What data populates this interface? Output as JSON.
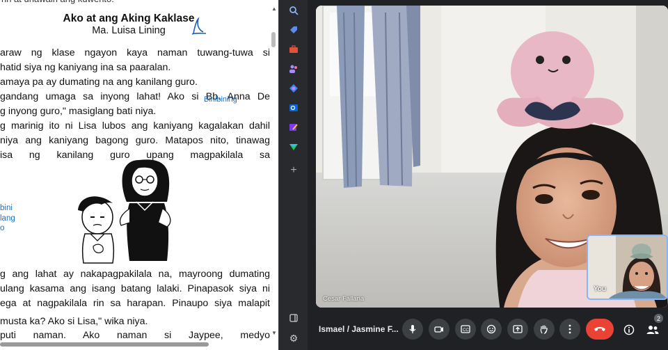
{
  "document": {
    "top_fragment": "rin at unawain ang kuwento.",
    "title": "Ako at ang Aking Kaklase",
    "author": "Ma. Luisa Lining",
    "paragraph1": [
      "araw ng klase ngayon kaya naman tuwang-tuwa si",
      "hatid siya ng kaniyang ina sa paaralan.",
      "amaya pa ay dumating na ang kanilang guro.",
      "gandang umaga sa inyong lahat!  Ako si Bb. Anna De",
      "g inyong  guro,\" masiglang bati niya.",
      "g marinig ito ni Lisa lubos ang kaniyang kagalakan dahil",
      "niya ang kaniyang bagong guro. Matapos nito, tinawag",
      "isa  ng  kanilang  guro  upang  magpakilala  sa"
    ],
    "annotation_binibining": "Binibining",
    "margin_notes": [
      "bini",
      "lang",
      "o"
    ],
    "paragraph2": [
      "g ang lahat ay nakapagpakilala na, mayroong dumating",
      "ulang kasama ang isang batang lalaki. Pinapasok siya ni",
      "ega at nagpakilala rin sa harapan. Pinaupo siya malapit"
    ],
    "paragraph3": [
      "musta ka?  Ako si Lisa,\" wika niya.",
      "puti  naman.  Ako  naman  si  Jaypee,  medyo"
    ]
  },
  "sidebar": {
    "icons": [
      "search-icon",
      "tag-icon",
      "toolbox-icon",
      "people-icon",
      "copilot-icon",
      "outlook-icon",
      "edit-icon",
      "send-icon",
      "add-icon",
      "panel-icon",
      "settings-icon"
    ]
  },
  "meet": {
    "main_participant_name": "Cesar Fallaria",
    "self_label": "You",
    "meeting_name": "Ismael / Jasmine F...",
    "participant_count": "2",
    "colors": {
      "end_call": "#ea4335",
      "control_bg": "#3c4043",
      "self_border": "#8ab4f8",
      "annotation": "#1a6fc4"
    }
  }
}
